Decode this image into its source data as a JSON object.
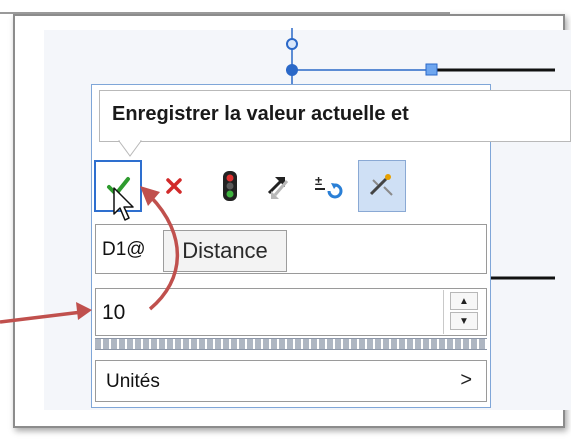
{
  "tooltip": {
    "title": "Enregistrer la valeur actuelle et"
  },
  "toolbar": {
    "buttons": [
      {
        "name": "ok",
        "icon": "check-icon"
      },
      {
        "name": "cancel",
        "icon": "close-icon"
      },
      {
        "name": "rebuild",
        "icon": "traffic-light-icon"
      },
      {
        "name": "reverse",
        "icon": "reverse-direction-icon"
      },
      {
        "name": "tolerance",
        "icon": "tolerance-icon"
      },
      {
        "name": "mark-dimension",
        "icon": "mark-dimension-icon"
      }
    ]
  },
  "name_field": {
    "value": "D1@"
  },
  "distance_tooltip": {
    "label": "Distance"
  },
  "value_field": {
    "value": "10"
  },
  "units_row": {
    "label": "Unités",
    "chevron": ">"
  },
  "colors": {
    "accent": "#2a68c8",
    "annotation": "#c0504d",
    "ok": "#2e9b2e",
    "cancel": "#d22a2a"
  }
}
